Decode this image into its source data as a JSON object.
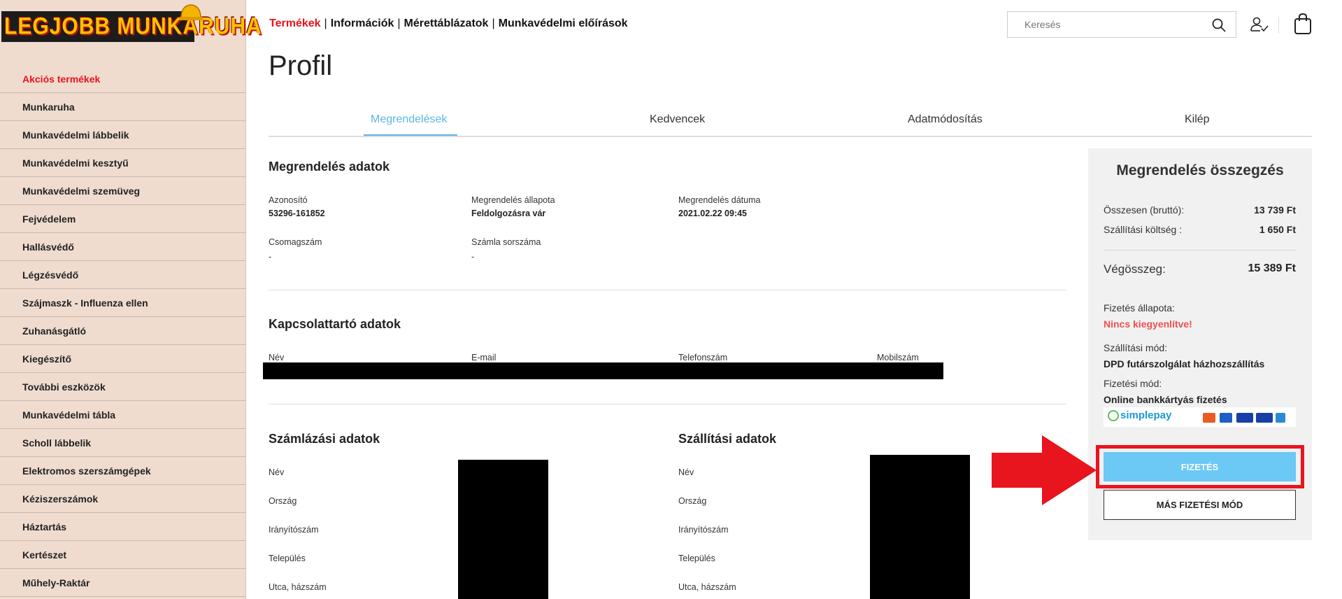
{
  "logo": {
    "text": "LEGJOBB MUNKARUHA"
  },
  "sidebar": {
    "items": [
      "Akciós termékek",
      "Munkaruha",
      "Munkavédelmi lábbelik",
      "Munkavédelmi kesztyű",
      "Munkavédelmi szemüveg",
      "Fejvédelem",
      "Hallásvédő",
      "Légzésvédő",
      "Szájmaszk - Influenza ellen",
      "Zuhanásgátló",
      "Kiegészítő",
      "További eszközök",
      "Munkavédelmi tábla",
      "Scholl lábbelik",
      "Elektromos szerszámgépek",
      "Kéziszerszámok",
      "Háztartás",
      "Kertészet",
      "Műhely-Raktár"
    ]
  },
  "topnav": {
    "items": [
      "Termékek",
      "Információk",
      "Mérettáblázatok",
      "Munkavédelmi előírások"
    ],
    "separator": "|"
  },
  "search": {
    "placeholder": "Keresés"
  },
  "page_title": "Profil",
  "tabs": [
    "Megrendelések",
    "Kedvencek",
    "Adatmódosítás",
    "Kilép"
  ],
  "order": {
    "title": "Megrendelés adatok",
    "id_label": "Azonosító",
    "id_value": "53296-161852",
    "status_label": "Megrendelés állapota",
    "status_value": "Feldolgozásra vár",
    "date_label": "Megrendelés dátuma",
    "date_value": "2021.02.22 09:45",
    "package_label": "Csomagszám",
    "package_value": "-",
    "invoice_label": "Számla sorszáma",
    "invoice_value": "-"
  },
  "contact": {
    "title": "Kapcsolattartó adatok",
    "name_label": "Név",
    "email_label": "E-mail",
    "phone_label": "Telefonszám",
    "mobile_label": "Mobilszám"
  },
  "billing": {
    "title": "Számlázási adatok",
    "labels": [
      "Név",
      "Ország",
      "Irányítószám",
      "Település",
      "Utca, házszám"
    ]
  },
  "shipping": {
    "title": "Szállítási adatok",
    "labels": [
      "Név",
      "Ország",
      "Irányítószám",
      "Település",
      "Utca, házszám"
    ]
  },
  "summary": {
    "title": "Megrendelés összegzés",
    "gross_label": "Összesen (bruttó):",
    "gross_value": "13 739 Ft",
    "shipping_label": "Szállítási költség :",
    "shipping_value": "1 650 Ft",
    "total_label": "Végösszeg:",
    "total_value": "15 389 Ft",
    "pay_status_label": "Fizetés állapota:",
    "pay_status_value": "Nincs kiegyenlítve!",
    "ship_method_label": "Szállítási mód:",
    "ship_method_value": "DPD futárszolgálat házhozszállítás",
    "pay_method_label": "Fizetési mód:",
    "pay_method_value": "Online bankkártyás fizetés",
    "simplepay_text": "simplepay",
    "pay_button": "FIZETÉS",
    "alt_button": "MÁS FIZETÉSI MÓD"
  },
  "colors": {
    "accent_red": "#e8141e",
    "tab_blue": "#5ab7e6",
    "pay_button": "#6cc8f4",
    "sidebar_bg": "#efdccf",
    "unpaid_red": "#ef5050"
  }
}
